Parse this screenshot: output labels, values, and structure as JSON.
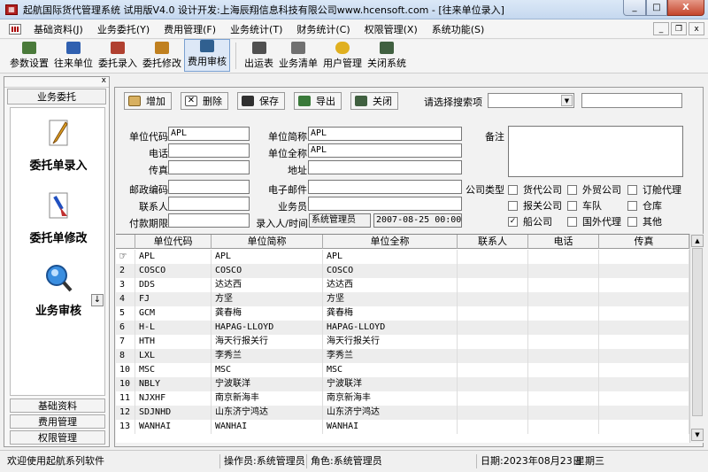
{
  "window": {
    "title": "起航国际货代管理系统 试用版V4.0 设计开发:上海辰翔信息科技有限公司www.hcensoft.com  - [往来单位录入]",
    "min": "_",
    "max": "□",
    "close": "X"
  },
  "menu": [
    "基础资料(J)",
    "业务委托(Y)",
    "费用管理(F)",
    "业务统计(T)",
    "财务统计(C)",
    "权限管理(X)",
    "系统功能(S)"
  ],
  "mdi": {
    "min": "_",
    "restore": "❐",
    "close": "x"
  },
  "toolbar": [
    {
      "label": "参数设置",
      "color": "#4a7a3a"
    },
    {
      "label": "往来单位",
      "color": "#3060b0"
    },
    {
      "label": "委托录入",
      "color": "#b04030"
    },
    {
      "label": "委托修改",
      "color": "#c08020"
    },
    {
      "label": "费用审核",
      "color": "#306090"
    },
    {
      "label": "出运表",
      "color": "#505050"
    },
    {
      "label": "业务清单",
      "color": "#707070"
    },
    {
      "label": "用户管理",
      "color": "#e0b020"
    },
    {
      "label": "关闭系统",
      "color": "#406040"
    }
  ],
  "left_panel": {
    "close": "x",
    "tab": "业务委托",
    "items": [
      "委托单录入",
      "委托单修改",
      "业务审核"
    ],
    "scroll": "↓",
    "bottom_tabs": [
      "基础资料",
      "费用管理",
      "权限管理"
    ]
  },
  "actions": {
    "add": "增加",
    "delete": "删除",
    "save": "保存",
    "export": "导出",
    "close": "关闭"
  },
  "search": {
    "label": "请选择搜索项",
    "arrow": "▼",
    "value": ""
  },
  "form": {
    "unit_code_label": "单位代码",
    "unit_code": "APL",
    "short_name_label": "单位简称",
    "short_name": "APL",
    "phone_label": "电话",
    "phone": "",
    "full_name_label": "单位全称",
    "full_name": "APL",
    "fax_label": "传真",
    "fax": "",
    "address_label": "地址",
    "address": "",
    "postcode_label": "邮政编码",
    "postcode": "",
    "email_label": "电子邮件",
    "email": "",
    "contact_label": "联系人",
    "contact": "",
    "salesman_label": "业务员",
    "salesman": "",
    "payment_label": "付款期限",
    "payment": "",
    "entry_label": "录入人/时间",
    "entry_user": "系统管理员",
    "entry_time": "2007-08-25 00:00:",
    "remark_label": "备注",
    "remark": "",
    "company_type_label": "公司类型",
    "company_types": [
      {
        "label": "货代公司",
        "checked": ""
      },
      {
        "label": "外贸公司",
        "checked": ""
      },
      {
        "label": "订舱代理",
        "checked": ""
      },
      {
        "label": "报关公司",
        "checked": ""
      },
      {
        "label": "车队",
        "checked": ""
      },
      {
        "label": "仓库",
        "checked": ""
      },
      {
        "label": "船公司",
        "checked": "✓"
      },
      {
        "label": "国外代理",
        "checked": ""
      },
      {
        "label": "其他",
        "checked": ""
      }
    ]
  },
  "grid": {
    "headers": [
      "单位代码",
      "单位简称",
      "单位全称",
      "联系人",
      "电话",
      "传真"
    ],
    "pointer": "☞",
    "rows": [
      {
        "no": "",
        "code": "APL",
        "short": "APL",
        "full": "APL"
      },
      {
        "no": "2",
        "code": "COSCO",
        "short": "COSCO",
        "full": "COSCO"
      },
      {
        "no": "3",
        "code": "DDS",
        "short": "达达西",
        "full": "达达西"
      },
      {
        "no": "4",
        "code": "FJ",
        "short": "方坚",
        "full": "方坚"
      },
      {
        "no": "5",
        "code": "GCM",
        "short": "龚春梅",
        "full": "龚春梅"
      },
      {
        "no": "6",
        "code": "H-L",
        "short": "HAPAG-LLOYD",
        "full": "HAPAG-LLOYD"
      },
      {
        "no": "7",
        "code": "HTH",
        "short": "海天行报关行",
        "full": "海天行报关行"
      },
      {
        "no": "8",
        "code": "LXL",
        "short": "李秀兰",
        "full": "李秀兰"
      },
      {
        "no": "10",
        "code": "MSC",
        "short": "MSC",
        "full": "MSC"
      },
      {
        "no": "10",
        "code": "NBLY",
        "short": "宁波联洋",
        "full": "宁波联洋"
      },
      {
        "no": "11",
        "code": "NJXHF",
        "short": "南京新海丰",
        "full": "南京新海丰"
      },
      {
        "no": "12",
        "code": "SDJNHD",
        "short": "山东济宁鸿达",
        "full": "山东济宁鸿达"
      },
      {
        "no": "13",
        "code": "WANHAI",
        "short": "WANHAI",
        "full": "WANHAI"
      }
    ],
    "scroll_up": "▲",
    "scroll_down": "▼"
  },
  "status": {
    "welcome": "欢迎使用起航系列软件",
    "operator": "操作员:系统管理员",
    "role": "角色:系统管理员",
    "date": "日期:2023年08月23日",
    "weekday": "星期三"
  }
}
